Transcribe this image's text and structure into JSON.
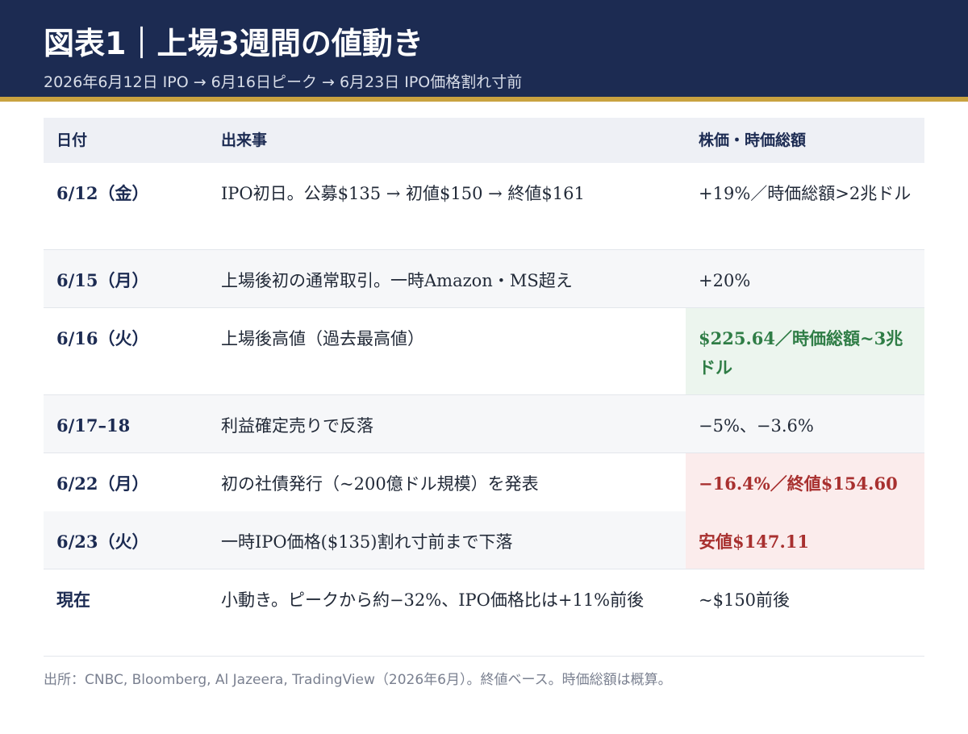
{
  "header": {
    "title": "図表1｜上場3週間の値動き",
    "subtitle": "2026年6月12日 IPO → 6月16日ピーク → 6月23日 IPO価格割れ寸前"
  },
  "table": {
    "columns": [
      "日付",
      "出来事",
      "株価・時価総額"
    ],
    "rows": [
      {
        "date": "6/12（金）",
        "event": "IPO初日。公募$135 → 初値$150 → 終値$161",
        "price": "+19%／時価総額>2兆ドル",
        "highlight": "none"
      },
      {
        "date": "6/15（月）",
        "event": "上場後初の通常取引。一時Amazon・MS超え",
        "price": "+20%",
        "highlight": "none"
      },
      {
        "date": "6/16（火）",
        "event": "上場後高値（過去最高値）",
        "price": "$225.64／時価総額~3兆ドル",
        "highlight": "green"
      },
      {
        "date": "6/17–18",
        "event": "利益確定売りで反落",
        "price": "−5%、−3.6%",
        "highlight": "none"
      },
      {
        "date": "6/22（月）",
        "event": "初の社債発行（~200億ドル規模）を発表",
        "price": "−16.4%／終値$154.60",
        "highlight": "red"
      },
      {
        "date": "6/23（火）",
        "event": "一時IPO価格($135)割れ寸前まで下落",
        "price": "安値$147.11",
        "highlight": "red"
      },
      {
        "date": "現在",
        "event": "小動き。ピークから約−32%、IPO価格比は+11%前後",
        "price": "~$150前後",
        "highlight": "none"
      }
    ]
  },
  "footer": {
    "source": "出所：CNBC, Bloomberg, Al Jazeera, TradingView（2026年6月）。終値ベース。時価総額は概算。"
  },
  "colors": {
    "header_bg": "#1c2b52",
    "accent_rule": "#c9a240",
    "positive_text": "#2f7d46",
    "positive_bg": "#ecf5ee",
    "negative_text": "#a8302f",
    "negative_bg": "#fbecec"
  }
}
